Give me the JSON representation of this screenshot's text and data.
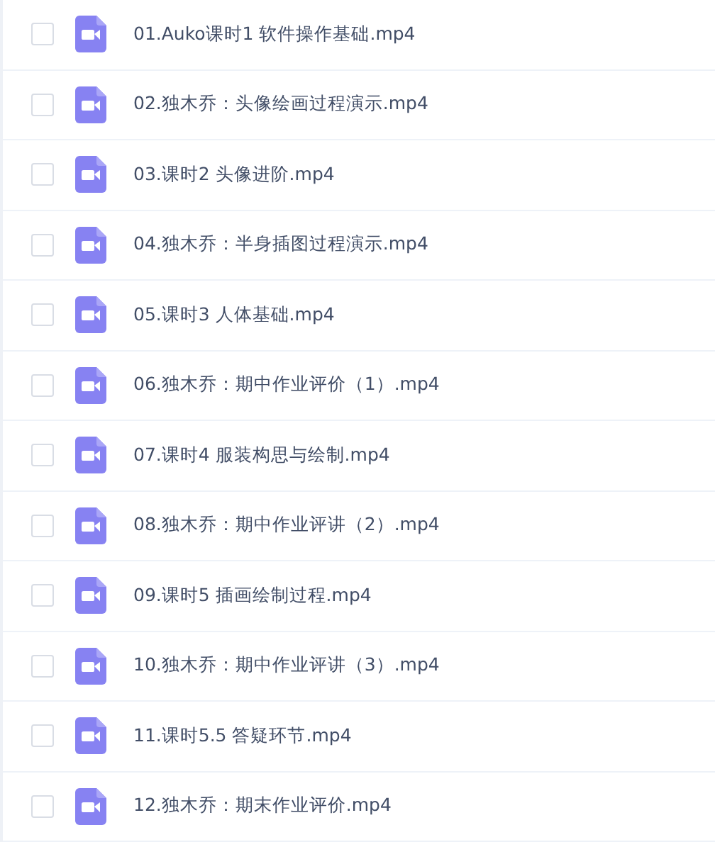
{
  "files": [
    {
      "name": "01.Auko课时1 软件操作基础.mp4",
      "checked": false
    },
    {
      "name": "02.独木乔：头像绘画过程演示.mp4",
      "checked": false
    },
    {
      "name": "03.课时2 头像进阶.mp4",
      "checked": false
    },
    {
      "name": "04.独木乔：半身插图过程演示.mp4",
      "checked": false
    },
    {
      "name": "05.课时3 人体基础.mp4",
      "checked": false
    },
    {
      "name": "06.独木乔：期中作业评价（1）.mp4",
      "checked": false
    },
    {
      "name": "07.课时4 服装构思与绘制.mp4",
      "checked": false
    },
    {
      "name": "08.独木乔：期中作业评讲（2）.mp4",
      "checked": false
    },
    {
      "name": "09.课时5 插画绘制过程.mp4",
      "checked": false
    },
    {
      "name": "10.独木乔：期中作业评讲（3）.mp4",
      "checked": false
    },
    {
      "name": "11.课时5.5 答疑环节.mp4",
      "checked": false
    },
    {
      "name": "12.独木乔：期末作业评价.mp4",
      "checked": false
    }
  ]
}
